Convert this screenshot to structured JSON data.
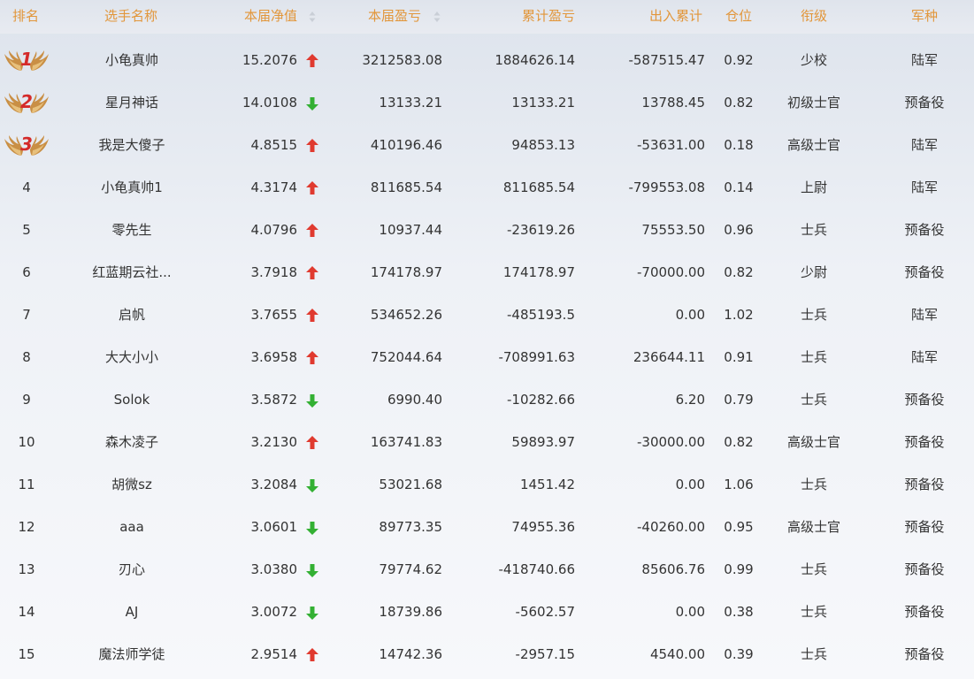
{
  "colors": {
    "header_text": "#e2963a",
    "up_arrow": "#e03a2f",
    "down_arrow": "#33b033",
    "badge_number": "#d42a2a",
    "wing_gold": "#c98f45"
  },
  "header": {
    "rank": "排名",
    "name": "选手名称",
    "net_value": "本届净值",
    "profit": "本届盈亏",
    "cumulative_profit": "累计盈亏",
    "cash_flow": "出入累计",
    "position": "仓位",
    "title": "衔级",
    "branch": "军种"
  },
  "rows": [
    {
      "rank": "1",
      "badge": "wings",
      "name": "小龟真帅",
      "net_value": "15.2076",
      "trend": "up",
      "profit": "3212583.08",
      "cumulative_profit": "1884626.14",
      "cash_flow": "-587515.47",
      "position": "0.92",
      "title": "少校",
      "branch": "陆军"
    },
    {
      "rank": "2",
      "badge": "wings",
      "name": "星月神话",
      "net_value": "14.0108",
      "trend": "down",
      "profit": "13133.21",
      "cumulative_profit": "13133.21",
      "cash_flow": "13788.45",
      "position": "0.82",
      "title": "初级士官",
      "branch": "预备役"
    },
    {
      "rank": "3",
      "badge": "wings",
      "name": "我是大傻子",
      "net_value": "4.8515",
      "trend": "up",
      "profit": "410196.46",
      "cumulative_profit": "94853.13",
      "cash_flow": "-53631.00",
      "position": "0.18",
      "title": "高级士官",
      "branch": "陆军"
    },
    {
      "rank": "4",
      "badge": "",
      "name": "小龟真帅1",
      "net_value": "4.3174",
      "trend": "up",
      "profit": "811685.54",
      "cumulative_profit": "811685.54",
      "cash_flow": "-799553.08",
      "position": "0.14",
      "title": "上尉",
      "branch": "陆军"
    },
    {
      "rank": "5",
      "badge": "",
      "name": "零先生",
      "net_value": "4.0796",
      "trend": "up",
      "profit": "10937.44",
      "cumulative_profit": "-23619.26",
      "cash_flow": "75553.50",
      "position": "0.96",
      "title": "士兵",
      "branch": "预备役"
    },
    {
      "rank": "6",
      "badge": "",
      "name": "红蓝期云社...",
      "net_value": "3.7918",
      "trend": "up",
      "profit": "174178.97",
      "cumulative_profit": "174178.97",
      "cash_flow": "-70000.00",
      "position": "0.82",
      "title": "少尉",
      "branch": "预备役"
    },
    {
      "rank": "7",
      "badge": "",
      "name": "启帆",
      "net_value": "3.7655",
      "trend": "up",
      "profit": "534652.26",
      "cumulative_profit": "-485193.5",
      "cash_flow": "0.00",
      "position": "1.02",
      "title": "士兵",
      "branch": "陆军"
    },
    {
      "rank": "8",
      "badge": "",
      "name": "大大小小",
      "net_value": "3.6958",
      "trend": "up",
      "profit": "752044.64",
      "cumulative_profit": "-708991.63",
      "cash_flow": "236644.11",
      "position": "0.91",
      "title": "士兵",
      "branch": "陆军"
    },
    {
      "rank": "9",
      "badge": "",
      "name": "Solok",
      "net_value": "3.5872",
      "trend": "down",
      "profit": "6990.40",
      "cumulative_profit": "-10282.66",
      "cash_flow": "6.20",
      "position": "0.79",
      "title": "士兵",
      "branch": "预备役"
    },
    {
      "rank": "10",
      "badge": "",
      "name": "森木凌子",
      "net_value": "3.2130",
      "trend": "up",
      "profit": "163741.83",
      "cumulative_profit": "59893.97",
      "cash_flow": "-30000.00",
      "position": "0.82",
      "title": "高级士官",
      "branch": "预备役"
    },
    {
      "rank": "11",
      "badge": "",
      "name": "胡微sz",
      "net_value": "3.2084",
      "trend": "down",
      "profit": "53021.68",
      "cumulative_profit": "1451.42",
      "cash_flow": "0.00",
      "position": "1.06",
      "title": "士兵",
      "branch": "预备役"
    },
    {
      "rank": "12",
      "badge": "",
      "name": "aaa",
      "net_value": "3.0601",
      "trend": "down",
      "profit": "89773.35",
      "cumulative_profit": "74955.36",
      "cash_flow": "-40260.00",
      "position": "0.95",
      "title": "高级士官",
      "branch": "预备役"
    },
    {
      "rank": "13",
      "badge": "",
      "name": "刃心",
      "net_value": "3.0380",
      "trend": "down",
      "profit": "79774.62",
      "cumulative_profit": "-418740.66",
      "cash_flow": "85606.76",
      "position": "0.99",
      "title": "士兵",
      "branch": "预备役"
    },
    {
      "rank": "14",
      "badge": "",
      "name": "AJ",
      "net_value": "3.0072",
      "trend": "down",
      "profit": "18739.86",
      "cumulative_profit": "-5602.57",
      "cash_flow": "0.00",
      "position": "0.38",
      "title": "士兵",
      "branch": "预备役"
    },
    {
      "rank": "15",
      "badge": "",
      "name": "魔法师学徒",
      "net_value": "2.9514",
      "trend": "up",
      "profit": "14742.36",
      "cumulative_profit": "-2957.15",
      "cash_flow": "4540.00",
      "position": "0.39",
      "title": "士兵",
      "branch": "预备役"
    }
  ]
}
